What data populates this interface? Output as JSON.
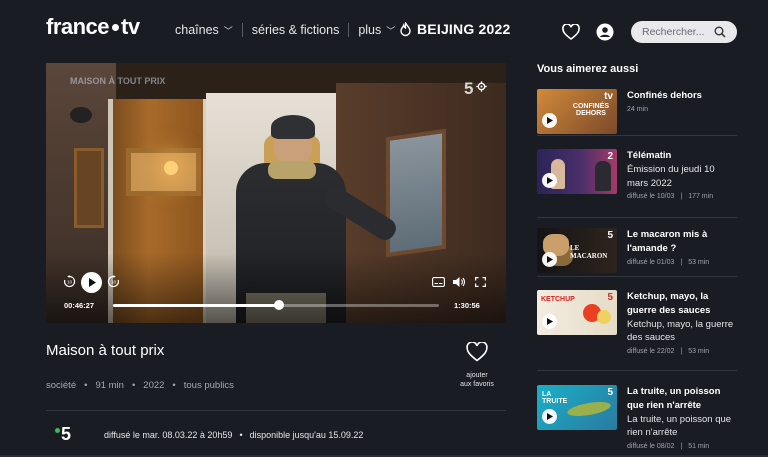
{
  "header": {
    "logo_left": "france",
    "logo_right": "tv",
    "nav": [
      {
        "label": "chaînes",
        "has_chevron": true
      },
      {
        "label": "séries & fictions",
        "has_chevron": false
      },
      {
        "label": "plus",
        "has_chevron": true
      }
    ],
    "event_label": "BEIJING 2022",
    "search_placeholder": "Rechercher..."
  },
  "player": {
    "current_time": "00:46:27",
    "total_time": "1:30:56",
    "progress_fraction": 0.51,
    "channel_mark": "5",
    "watermark": "MAISON À TOUT PRIX"
  },
  "program": {
    "title": "Maison à tout prix",
    "meta": [
      "société",
      "91 min",
      "2022",
      "tous publics"
    ],
    "fav_label_1": "ajouter",
    "fav_label_2": "aux favoris",
    "channel": "5",
    "broadcast": "diffusé le mar. 08.03.22 à 20h59",
    "available": "disponible jusqu'au 15.09.22"
  },
  "sidebar": {
    "title": "Vous aimerez aussi",
    "items": [
      {
        "title": "Confinés dehors",
        "subtitle": "",
        "meta_date": "",
        "meta_duration": "24 min",
        "thumb_text": "CONFINÉS DEHORS",
        "thumb_channel": "tv",
        "thumb_colors": [
          "#d38a3a",
          "#7a4a2a"
        ]
      },
      {
        "title": "Télématin",
        "subtitle": "Émission du jeudi 10 mars 2022",
        "meta_date": "diffusé le 10/03",
        "meta_duration": "177 min",
        "thumb_text": "",
        "thumb_channel": "2",
        "thumb_colors": [
          "#3a2c6a",
          "#b03a6a"
        ]
      },
      {
        "title": "Le macaron mis à l'amande ?",
        "subtitle": "",
        "meta_date": "diffusé le 01/03",
        "meta_duration": "53 min",
        "thumb_text": "LE MACARON",
        "thumb_channel": "5",
        "thumb_colors": [
          "#141414",
          "#3a2a22"
        ]
      },
      {
        "title": "Ketchup, mayo, la guerre des sauces",
        "subtitle": "Ketchup, mayo, la guerre des sauces",
        "meta_date": "diffusé le 22/02",
        "meta_duration": "53 min",
        "thumb_text": "KETCHUP",
        "thumb_channel": "5",
        "thumb_colors": [
          "#f2ece0",
          "#e8ddc8"
        ]
      },
      {
        "title": "La truite, un poisson que rien n'arrête",
        "subtitle": "La truite, un poisson que rien n'arrête",
        "meta_date": "diffusé le 08/02",
        "meta_duration": "51 min",
        "thumb_text": "LA TRUITE",
        "thumb_channel": "5",
        "thumb_colors": [
          "#1aa0b8",
          "#2a7fa0"
        ]
      }
    ]
  }
}
